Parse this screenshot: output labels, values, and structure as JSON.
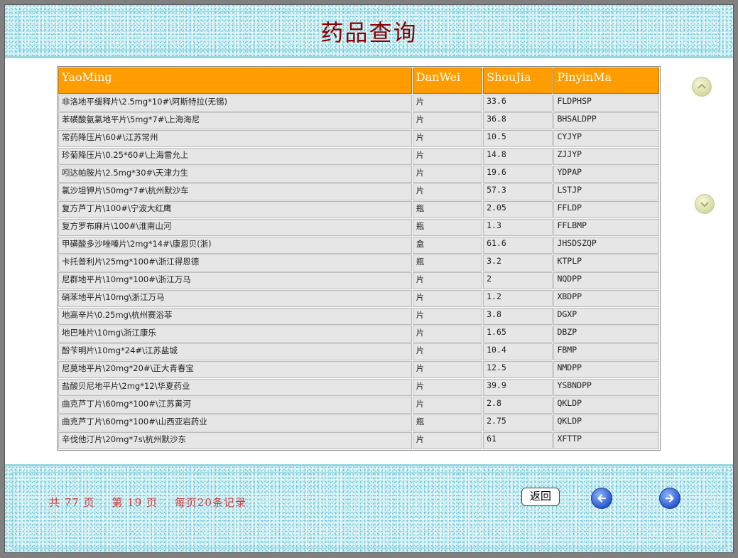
{
  "title": "药品查询",
  "table": {
    "headers": [
      "YaoMing",
      "DanWei",
      "ShouJia",
      "PinyinMa"
    ],
    "rows": [
      [
        "非洛地平缓释片\\2.5mg*10#\\阿斯特拉(无锡)",
        "片",
        "33.6",
        "FLDPHSP"
      ],
      [
        "苯磺酸氨氯地平片\\5mg*7#\\上海海尼",
        "片",
        "36.8",
        "BHSALDPP"
      ],
      [
        "常药降压片\\60#\\江苏常州",
        "片",
        "10.5",
        "CYJYP"
      ],
      [
        "珍菊降压片\\0.25*60#\\上海雷允上",
        "片",
        "14.8",
        "ZJJYP"
      ],
      [
        "吲达帕胺片\\2.5mg*30#\\天津力生",
        "片",
        "19.6",
        "YDPAP"
      ],
      [
        "氯沙坦钾片\\50mg*7#\\杭州默沙车",
        "片",
        "57.3",
        "LSTJP"
      ],
      [
        "复方芦丁片\\100#\\宁波大红鹰",
        "瓶",
        "2.05",
        "FFLDP"
      ],
      [
        "复方罗布麻片\\100#\\淮南山河",
        "瓶",
        "1.3",
        "FFLBMP"
      ],
      [
        "甲磺酸多沙唑嗪片\\2mg*14#\\康恩贝(浙)",
        "盒",
        "61.6",
        "JHSDSZQP"
      ],
      [
        "卡托普利片\\25mg*100#\\浙江得恩德",
        "瓶",
        "3.2",
        "KTPLP"
      ],
      [
        "尼群地平片\\10mg*100#\\浙江万马",
        "片",
        "2",
        "NQDPP"
      ],
      [
        "硝苯地平片\\10mg\\浙江万马",
        "片",
        "1.2",
        "XBDPP"
      ],
      [
        "地高辛片\\0.25mg\\杭州赛浴菲",
        "片",
        "3.8",
        "DGXP"
      ],
      [
        "地巴唑片\\10mg\\浙江康乐",
        "片",
        "1.65",
        "DBZP"
      ],
      [
        "酚苄明片\\10mg*24#\\江苏盐城",
        "片",
        "10.4",
        "FBMP"
      ],
      [
        "尼莫地平片\\20mg*20#\\正大青春宝",
        "片",
        "12.5",
        "NMDPP"
      ],
      [
        "盐酸贝尼地平片\\2mg*12\\华夏药业",
        "片",
        "39.9",
        "YSBNDPP"
      ],
      [
        "曲克芦丁片\\60mg*100#\\江苏黄河",
        "片",
        "2.8",
        "QKLDP"
      ],
      [
        "曲克芦丁片\\60mg*100#\\山西亚岩药业",
        "瓶",
        "2.75",
        "QKLDP"
      ],
      [
        "辛伐他汀片\\20mg*7s\\杭州默沙东",
        "片",
        "61",
        "XFTTP"
      ]
    ]
  },
  "pager": {
    "total_pages": "共 77 页",
    "current_page": "第 19 页",
    "per_page": "每页20条记录"
  },
  "buttons": {
    "back_label": "返回",
    "prev_icon": "arrow-left-icon",
    "next_icon": "arrow-right-icon",
    "scroll_up_icon": "chevron-up-icon",
    "scroll_down_icon": "chevron-down-icon"
  },
  "colors": {
    "title": "#8b0000",
    "header_bg": "#ff9d00",
    "pager_text": "#d33a3a",
    "nav_button": "#2f5fd4"
  }
}
